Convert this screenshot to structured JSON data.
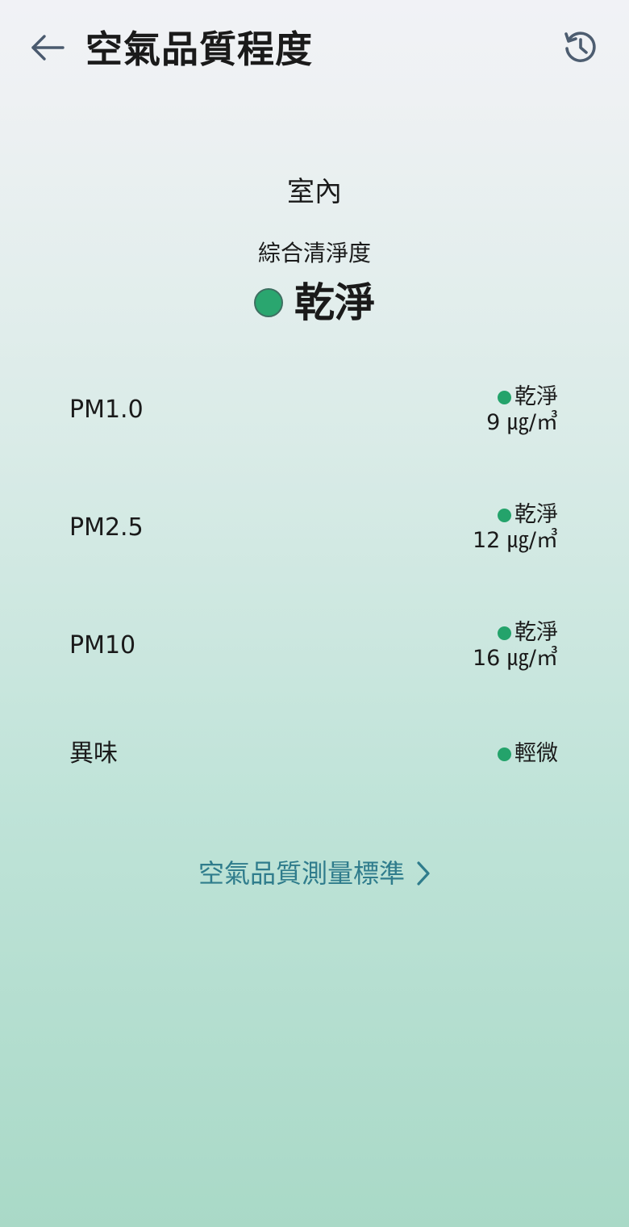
{
  "header": {
    "title": "空氣品質程度",
    "back_icon": "arrow-left-icon",
    "history_icon": "history-icon"
  },
  "location": "室內",
  "overall": {
    "label": "綜合清淨度",
    "value": "乾淨",
    "status_color": "#2aa66f"
  },
  "metrics": [
    {
      "name": "PM1.0",
      "status": "乾淨",
      "value": "9 ㎍/㎥"
    },
    {
      "name": "PM2.5",
      "status": "乾淨",
      "value": "12 ㎍/㎥"
    },
    {
      "name": "PM10",
      "status": "乾淨",
      "value": "16 ㎍/㎥"
    },
    {
      "name": "異味",
      "status": "輕微"
    }
  ],
  "standard_link": {
    "label": "空氣品質測量標準",
    "icon": "chevron-right-icon",
    "color": "#2f7c8c"
  }
}
